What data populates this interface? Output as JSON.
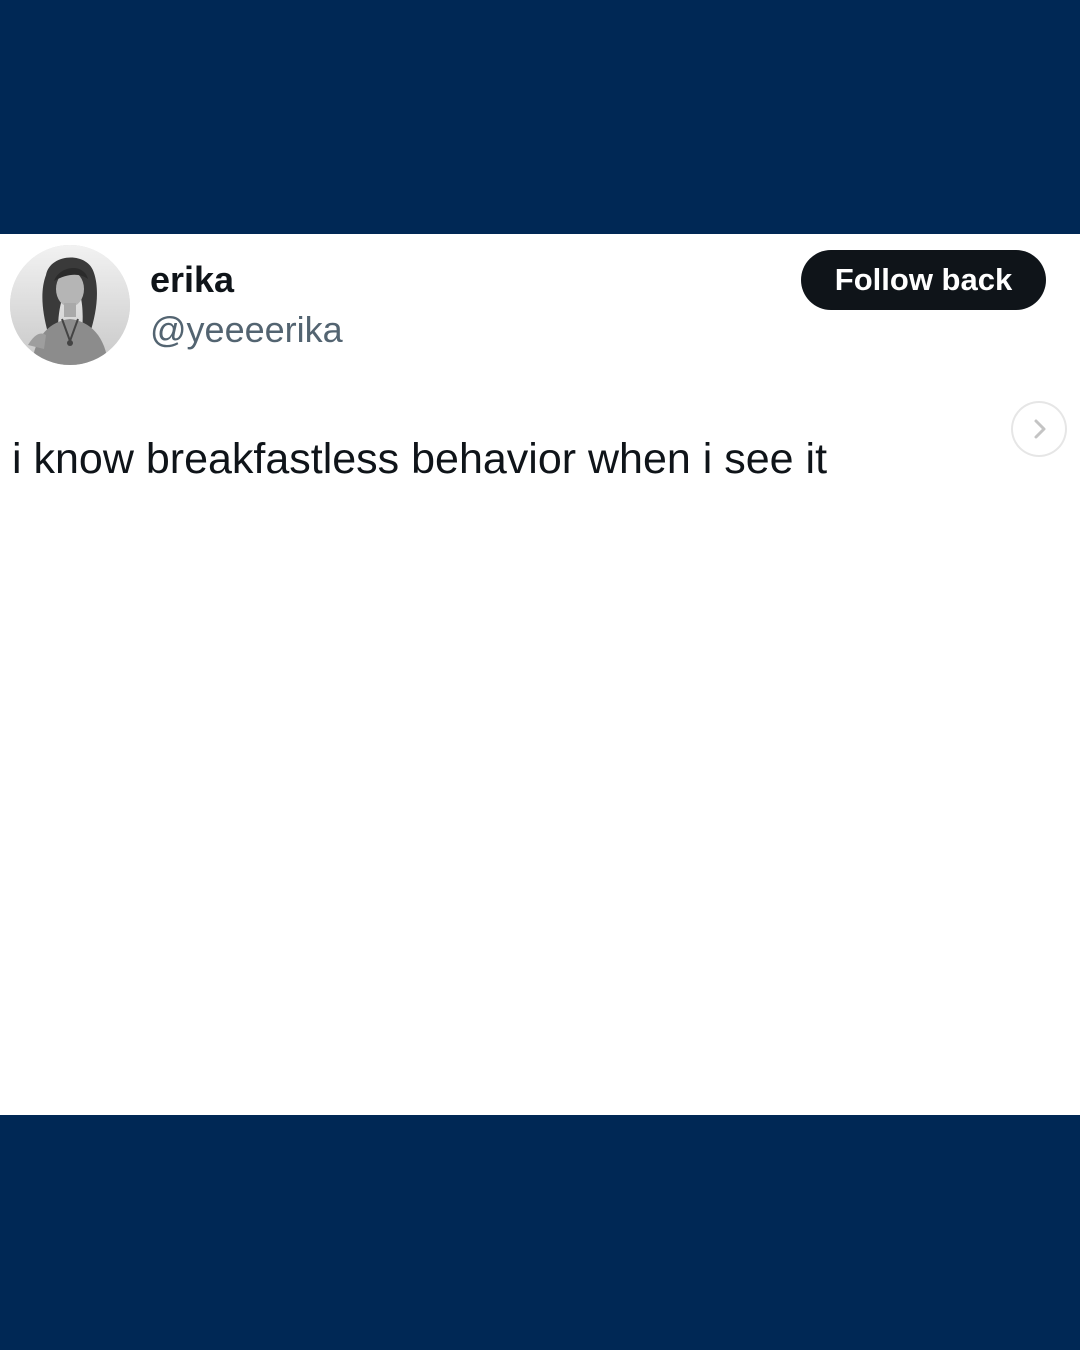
{
  "colors": {
    "background_band": "#002855",
    "card": "#ffffff",
    "name_text": "#0f1419",
    "handle_text": "#536471",
    "button_bg": "#0f1419",
    "button_text": "#ffffff"
  },
  "tweet": {
    "author": {
      "name": "erika",
      "handle": "@yeeeerika",
      "avatar_icon": "profile-photo"
    },
    "follow_button_label": "Follow back",
    "text": "i know breakfastless behavior when i see it"
  },
  "carousel": {
    "next_icon": "chevron-right-icon"
  }
}
